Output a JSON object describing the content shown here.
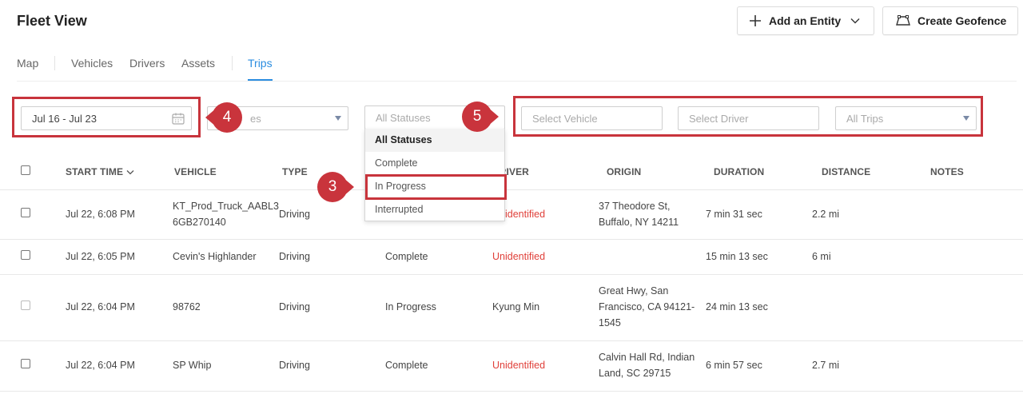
{
  "header": {
    "title": "Fleet View",
    "add_entity_label": "Add an Entity",
    "create_geofence_label": "Create Geofence"
  },
  "tabs": [
    {
      "label": "Map"
    },
    {
      "label": "Vehicles"
    },
    {
      "label": "Drivers"
    },
    {
      "label": "Assets"
    },
    {
      "label": "Trips",
      "active": true
    }
  ],
  "filters": {
    "date_range": "Jul 16 - Jul 23",
    "types_placeholder": "es",
    "status_value": "All Statuses",
    "vehicle_placeholder": "Select Vehicle",
    "driver_placeholder": "Select Driver",
    "trips_value": "All Trips"
  },
  "status_dropdown": {
    "options": [
      "All Statuses",
      "Complete",
      "In Progress",
      "Interrupted"
    ],
    "selected": "All Statuses"
  },
  "callouts": [
    "4",
    "5",
    "3"
  ],
  "callout_color": "#c9343c",
  "accent_color": "#2b8de0",
  "table": {
    "columns": {
      "start_time": "START TIME",
      "vehicle": "VEHICLE",
      "type": "TYPE",
      "driver": "DRIVER",
      "origin": "ORIGIN",
      "duration": "DURATION",
      "distance": "DISTANCE",
      "notes": "NOTES"
    },
    "rows": [
      {
        "start": "Jul 22, 6:08 PM",
        "vehicle": [
          "KT_Prod_Truck_AABL3",
          "6GB270140"
        ],
        "type": "Driving",
        "status": "",
        "driver": "Unidentified",
        "origin": [
          "37 Theodore St,",
          "Buffalo, NY 14211"
        ],
        "duration": "7 min 31 sec",
        "distance": "2.2 mi"
      },
      {
        "start": "Jul 22, 6:05 PM",
        "vehicle": [
          "Cevin's Highlander"
        ],
        "type": "Driving",
        "status": "Complete",
        "driver": "Unidentified",
        "origin": [],
        "duration": "15 min 13 sec",
        "distance": "6 mi"
      },
      {
        "start": "Jul 22, 6:04 PM",
        "vehicle": [
          "98762"
        ],
        "type": "Driving",
        "status": "In Progress",
        "driver": "Kyung Min",
        "origin": [
          "Great Hwy, San",
          "Francisco, CA 94121-",
          "1545"
        ],
        "duration": "24 min 13 sec",
        "distance": ""
      },
      {
        "start": "Jul 22, 6:04 PM",
        "vehicle": [
          "SP Whip"
        ],
        "type": "Driving",
        "status": "Complete",
        "driver": "Unidentified",
        "origin": [
          "Calvin Hall Rd, Indian",
          "Land, SC 29715"
        ],
        "duration": "6 min 57 sec",
        "distance": "2.7 mi"
      }
    ]
  }
}
